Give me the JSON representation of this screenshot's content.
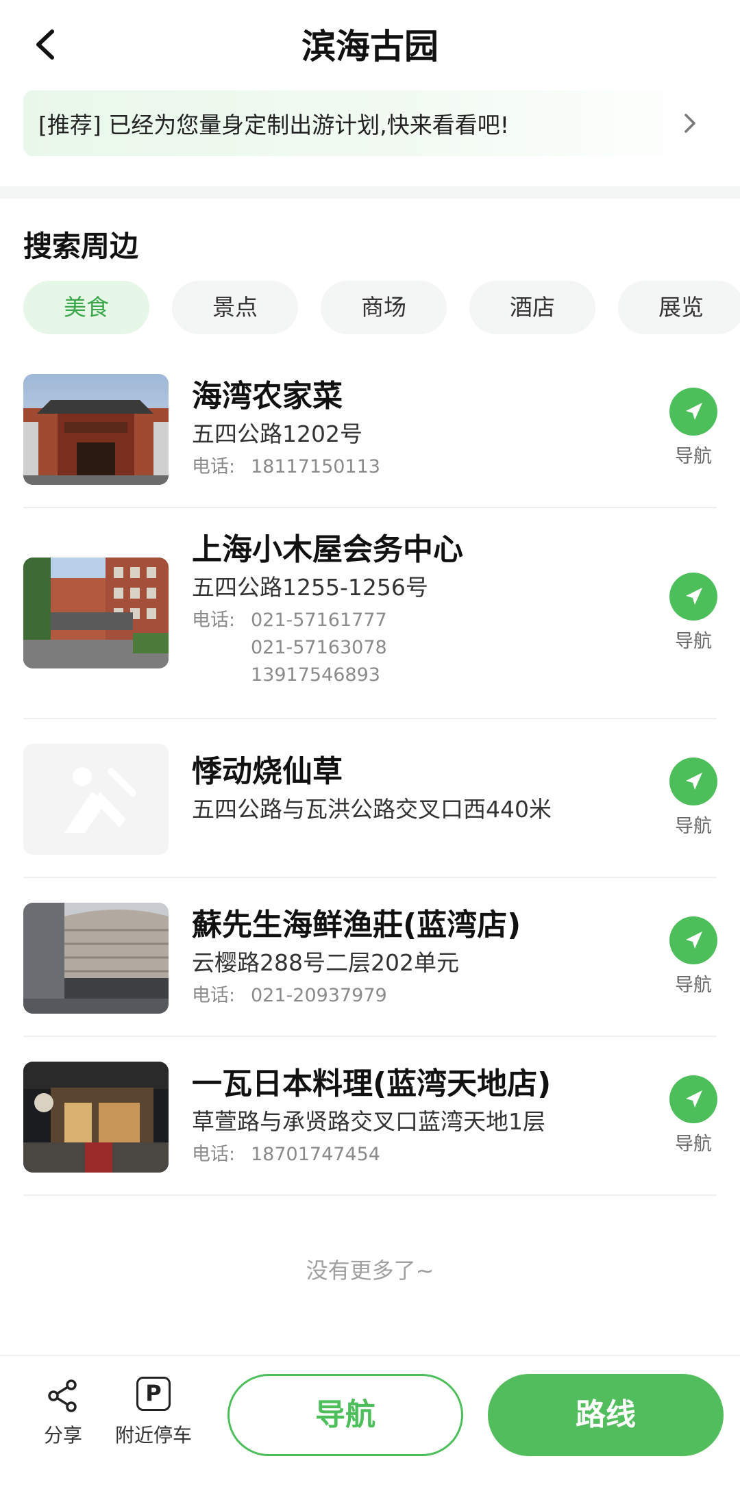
{
  "header": {
    "title": "滨海古园",
    "back_icon": "chevron-left-icon"
  },
  "banner": {
    "text": "[推荐] 已经为您量身定制出游计划,快来看看吧!",
    "chevron_icon": "chevron-right-icon"
  },
  "nearby": {
    "title": "搜索周边",
    "categories": [
      {
        "label": "美食",
        "active": true
      },
      {
        "label": "景点",
        "active": false
      },
      {
        "label": "商场",
        "active": false
      },
      {
        "label": "酒店",
        "active": false
      },
      {
        "label": "展览",
        "active": false
      }
    ]
  },
  "places": [
    {
      "name": "海湾农家菜",
      "address": "五四公路1202号",
      "phone_label": "电话:",
      "phones": [
        "18117150113"
      ],
      "nav_label": "导航",
      "thumb": "restaurant-photo"
    },
    {
      "name": "上海小木屋会务中心",
      "address": "五四公路1255-1256号",
      "phone_label": "电话:",
      "phones": [
        "021-57161777",
        "021-57163078",
        "13917546893"
      ],
      "nav_label": "导航",
      "thumb": "building-photo"
    },
    {
      "name": "悸动烧仙草",
      "address": "五四公路与瓦洪公路交叉口西440米",
      "phone_label": "",
      "phones": [],
      "nav_label": "导航",
      "thumb": "placeholder-photo"
    },
    {
      "name": "蘇先生海鲜渔莊(蓝湾店)",
      "address": "云樱路288号二层202单元",
      "phone_label": "电话:",
      "phones": [
        "021-20937979"
      ],
      "nav_label": "导航",
      "thumb": "mall-photo"
    },
    {
      "name": "一瓦日本料理(蓝湾天地店)",
      "address": "草萱路与承贤路交叉口蓝湾天地1层",
      "phone_label": "电话:",
      "phones": [
        "18701747454"
      ],
      "nav_label": "导航",
      "thumb": "night-storefront-photo"
    }
  ],
  "end_text": "没有更多了~",
  "bottom_bar": {
    "share_label": "分享",
    "parking_label": "附近停车",
    "parking_letter": "P",
    "navigate_label": "导航",
    "route_label": "路线"
  },
  "colors": {
    "accent": "#4cbf5b",
    "chip_active_bg": "#e6f6e7",
    "chip_bg": "#f4f5f5"
  }
}
